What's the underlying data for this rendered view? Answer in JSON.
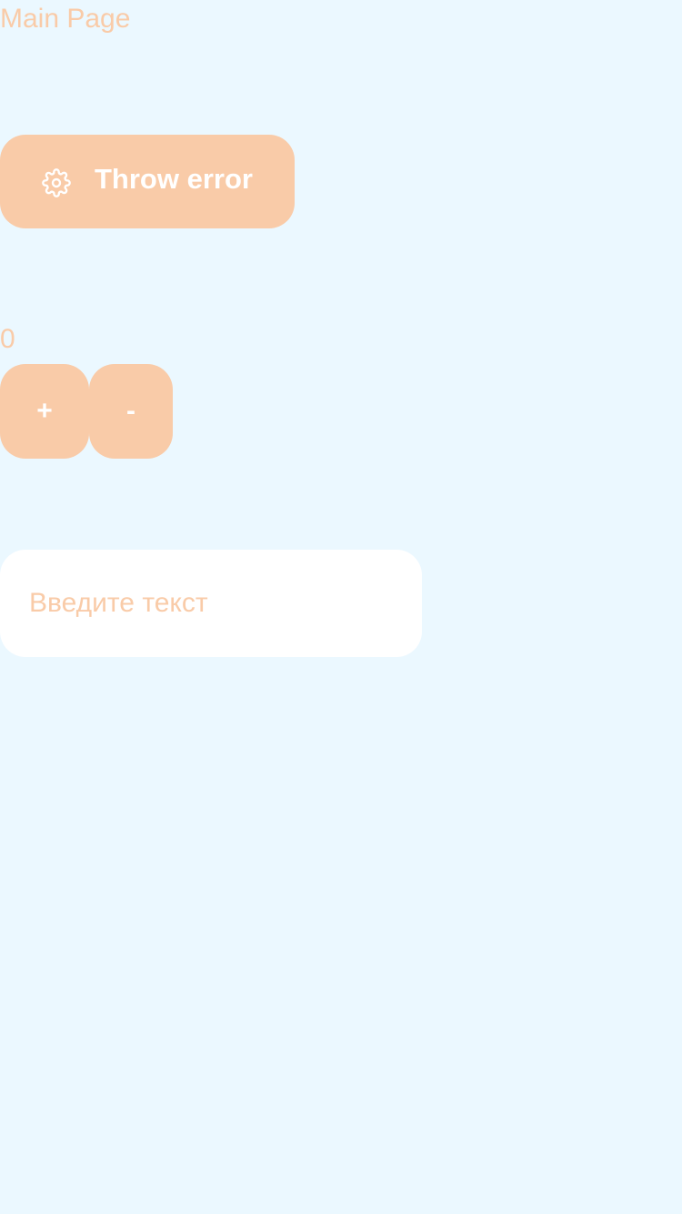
{
  "page": {
    "title": "Main Page"
  },
  "error_button": {
    "label": "Throw error",
    "icon": "gear-icon"
  },
  "counter": {
    "value": "0",
    "increment_label": "+",
    "decrement_label": "-"
  },
  "text_field": {
    "value": "",
    "placeholder": "Введите текст"
  },
  "colors": {
    "background": "#ebf8ff",
    "accent": "#f9cba8",
    "button_text": "#ffffff",
    "input_background": "#ffffff"
  }
}
